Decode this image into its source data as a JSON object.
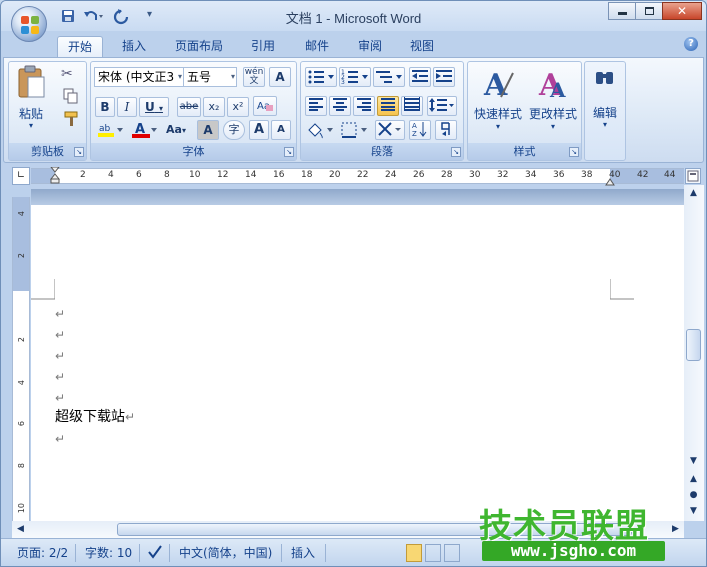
{
  "window": {
    "title": "文档 1 - Microsoft Word"
  },
  "quick_access": {
    "save_icon": "save-icon",
    "undo_icon": "undo-icon",
    "redo_icon": "redo-icon"
  },
  "tabs": [
    {
      "label": "开始",
      "active": true
    },
    {
      "label": "插入"
    },
    {
      "label": "页面布局"
    },
    {
      "label": "引用"
    },
    {
      "label": "邮件"
    },
    {
      "label": "审阅"
    },
    {
      "label": "视图"
    }
  ],
  "ribbon": {
    "clipboard": {
      "label": "剪贴板",
      "paste_label": "粘贴"
    },
    "font": {
      "label": "字体",
      "font_name": "宋体 (中文正3",
      "font_size": "五号",
      "bold": "B",
      "italic": "I",
      "underline": "U",
      "strike": "abe",
      "subscript": "x₂",
      "superscript": "x²",
      "clear": "Aa",
      "grow": "A",
      "shrink": "A",
      "wen": "wén",
      "phonetic": "文",
      "char_border": "A",
      "char_shade": "A",
      "enclose": "字"
    },
    "paragraph": {
      "label": "段落"
    },
    "styles": {
      "label": "样式",
      "quick_styles": "快速样式",
      "change_styles": "更改样式"
    },
    "editing": {
      "label": "编辑"
    }
  },
  "ruler": {
    "h_ticks": [
      "2",
      "4",
      "6",
      "8",
      "10",
      "12",
      "14",
      "16",
      "18",
      "20",
      "22",
      "24",
      "26",
      "28",
      "30",
      "32",
      "34",
      "36",
      "38",
      "40",
      "42",
      "44"
    ],
    "v_ticks": [
      "4",
      "2",
      "2",
      "4",
      "6",
      "8",
      "10"
    ]
  },
  "document": {
    "text_line": "超级下载站",
    "para_mark": "↵"
  },
  "status": {
    "page": "页面: 2/2",
    "words": "字数: 10",
    "language": "中文(简体，中国)",
    "mode": "插入"
  },
  "watermark": {
    "main": "技术员联盟",
    "url": "www.jsgho.com"
  }
}
